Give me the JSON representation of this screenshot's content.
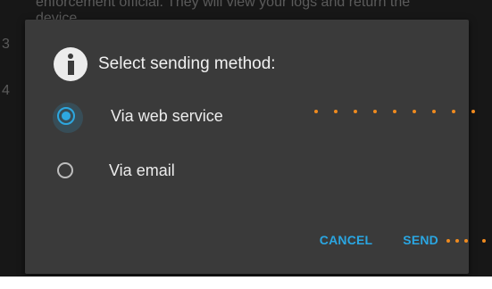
{
  "background": {
    "text_line1": "enforcement official. They will view your logs and return the",
    "text_line2": "device...",
    "step_numbers": [
      "3",
      "4"
    ]
  },
  "dialog": {
    "title": "Select sending method:",
    "icon": "info-icon",
    "options": [
      {
        "label": "Via web service",
        "selected": true
      },
      {
        "label": "Via email",
        "selected": false
      }
    ],
    "actions": {
      "cancel_label": "CANCEL",
      "send_label": "SEND"
    }
  },
  "colors": {
    "accent": "#2aa6e2",
    "callout_dots": "#ef8a1f",
    "dialog_background": "#3a3a3a"
  }
}
